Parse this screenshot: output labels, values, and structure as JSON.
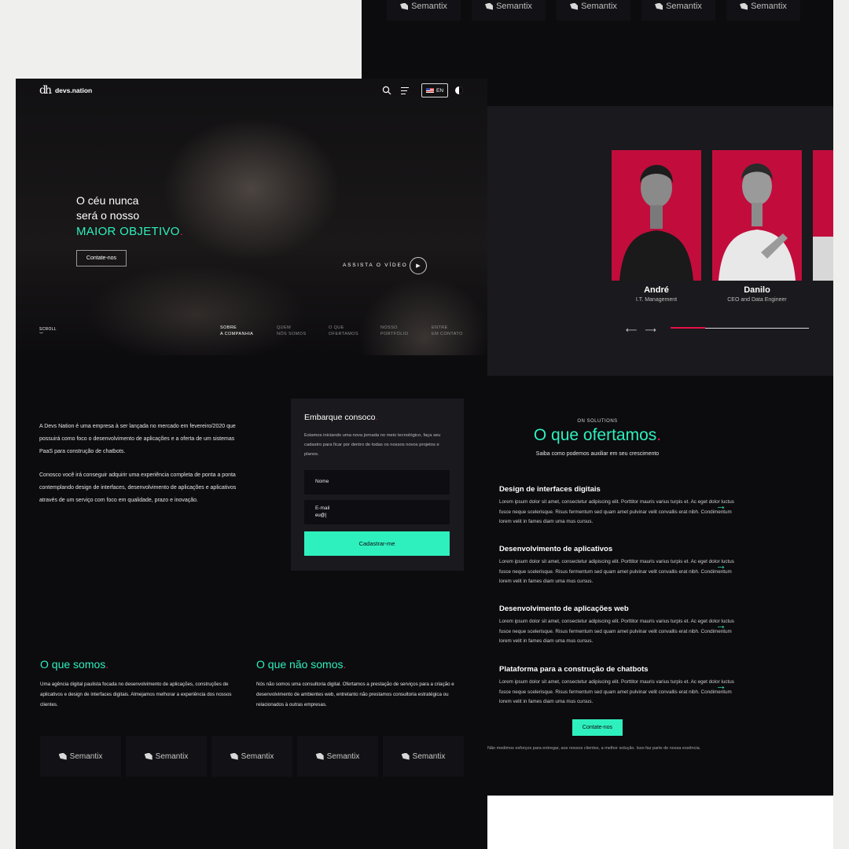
{
  "brand": {
    "name": "devs.nation",
    "mark": "dh"
  },
  "nav": {
    "lang": "EN"
  },
  "hero": {
    "line1": "O céu nunca",
    "line2": "será o nosso",
    "line3": "MAIOR OBJETIVO",
    "cta": "Contate-nos",
    "watch": "ASSISTA O VÍDEO",
    "scroll": "SCROLL",
    "tabs": [
      {
        "l1": "SOBRE",
        "l2": "A COMPANHIA"
      },
      {
        "l1": "QUEM",
        "l2": "NÓS SOMOS"
      },
      {
        "l1": "O QUE",
        "l2": "OFERTAMOS"
      },
      {
        "l1": "NOSSO",
        "l2": "PORTFÓLIO"
      },
      {
        "l1": "ENTRE",
        "l2": "EM CONTATO"
      }
    ]
  },
  "about": {
    "p1": "A Devs Nation é uma empresa à ser lançada no mercado em fevereiro/2020 que possuirá como foco o desenvolvimento de aplicações e a oferta de um sistemas PaaS para construção de chatbots.",
    "p2": "Conosco você irá conseguir adquirir uma experiência completa de ponta a ponta contemplando design de interfaces, desenvolvimento de aplicações e aplicativos através de um serviço com foco em qualidade, prazo e inovação."
  },
  "signup": {
    "title": "Embarque consoco",
    "intro": "Estamos iniciando uma nova jornada no meio tecnológico, faça seu cadastro para ficar por dentro de todas os nossos novos projetos e planos.",
    "name_label": "Nome",
    "email_label": "E-mail",
    "email_value": "eu@|",
    "submit": "Cadastrar-me"
  },
  "who": {
    "title": "O que somos",
    "text": "Uma agência digital paulista focada no desenvolvimento de aplicações, construções de aplicativos e design de interfaces digitais. Almejamos melhorar a experiência dos nossos clientes."
  },
  "whonot": {
    "title": "O que não somos",
    "text": "Nós não somos uma consultoria digital. Ofertamos a prestação de serviços para a criação e desenvolvimento de ambientes web, entretanto não prestamos consultoria estratégica ou relacionados à outras empresas."
  },
  "partners": [
    "Semantix",
    "Semantix",
    "Semantix",
    "Semantix",
    "Semantix"
  ],
  "team": [
    {
      "name": "André",
      "role": "I.T. Management"
    },
    {
      "name": "Danilo",
      "role": "CEO and Data Engineer"
    }
  ],
  "slider": {
    "prev": "⟵",
    "next": "⟶",
    "progress": 0.25
  },
  "offers": {
    "eyebrow": "ON SOLUTIONS",
    "title": "O que ofertamos",
    "subtitle": "Saiba como podemos auxiliar em seu crescimento",
    "items": [
      {
        "title": "Design de interfaces digitais",
        "text": "Lorem ipsum dolor sit amet, consectetur adipiscing elit. Porttitor mauris varius turpis et. Ac eget dolor luctus fusce neque scelerisque. Risus fermentum sed quam amet pulvinar velit convallis erat nibh. Condimentum lorem velit in fames diam uma mus cursus."
      },
      {
        "title": "Desenvolvimento de aplicativos",
        "text": "Lorem ipsum dolor sit amet, consectetur adipiscing elit. Porttitor mauris varius turpis et. Ac eget dolor luctus fusce neque scelerisque. Risus fermentum sed quam amet pulvinar velit convallis erat nibh. Condimentum lorem velit in fames diam uma mus cursus."
      },
      {
        "title": "Desenvolvimento de aplicações web",
        "text": "Lorem ipsum dolor sit amet, consectetur adipiscing elit. Porttitor mauris varius turpis et. Ac eget dolor luctus fusce neque scelerisque. Risus fermentum sed quam amet pulvinar velit convallis erat nibh. Condimentum lorem velit in fames diam uma mus cursus."
      },
      {
        "title": "Plataforma para a construção de chatbots",
        "text": "Lorem ipsum dolor sit amet, consectetur adipiscing elit. Porttitor mauris varius turpis et. Ac eget dolor luctus fusce neque scelerisque. Risus fermentum sed quam amet pulvinar velit convallis erat nibh. Condimentum lorem velit in fames diam uma mus cursus."
      }
    ],
    "cta": "Contate-nos",
    "footer": "Não medimos esforços para entregar, aos nossos clientes, a melhor solução. Isso faz parte de nossa essência."
  },
  "colors": {
    "accent": "#2ef0be",
    "highlight": "#e8104a",
    "background": "#0c0b0e",
    "team_bg": "#c20d3c"
  }
}
